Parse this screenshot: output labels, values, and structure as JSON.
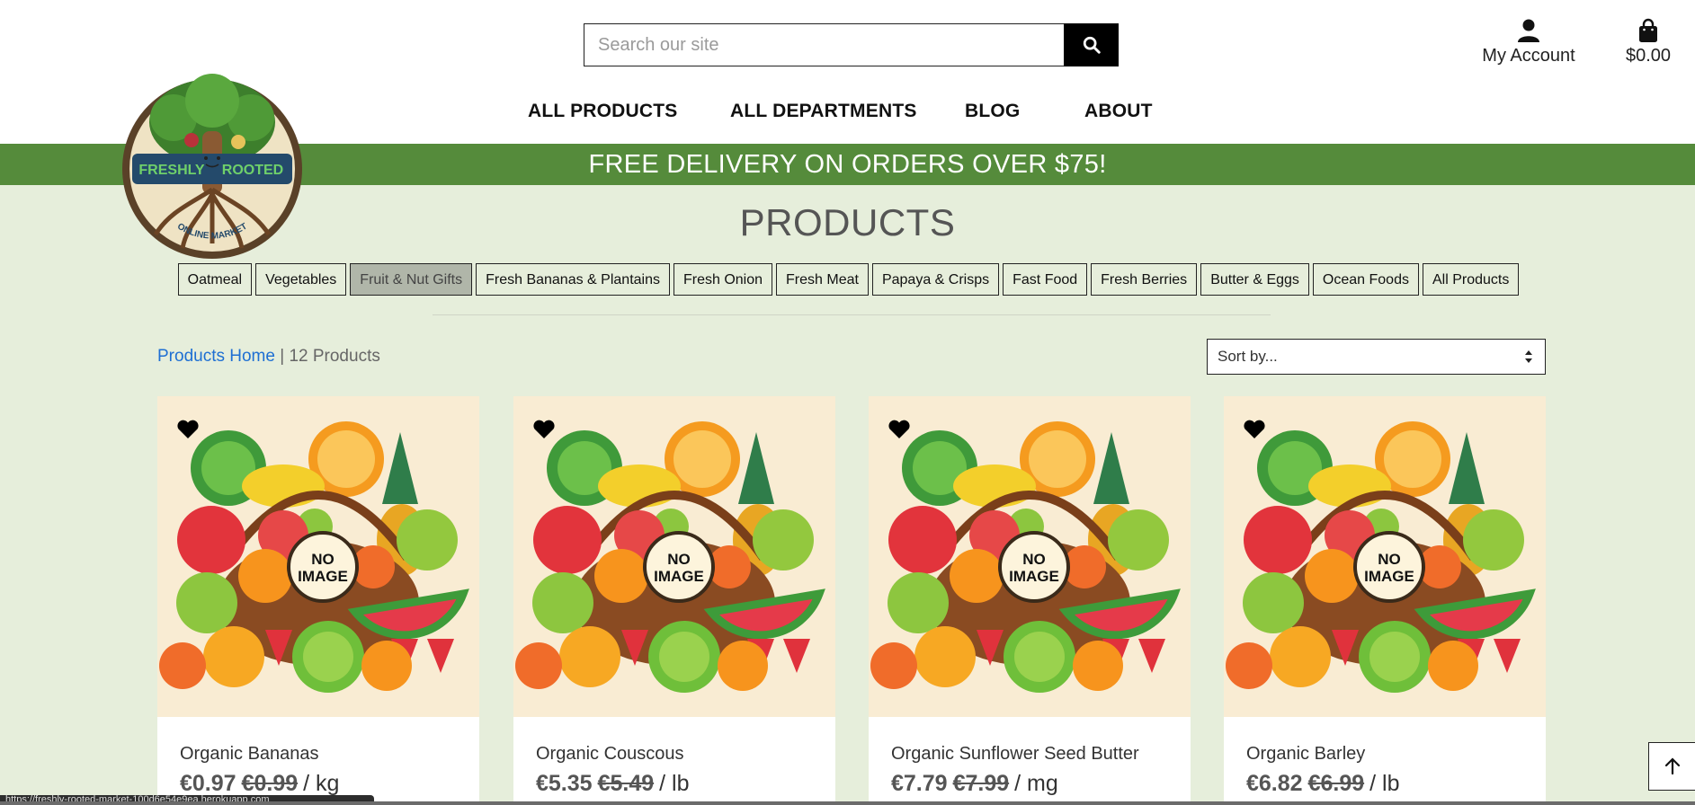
{
  "header": {
    "search_placeholder": "Search our site",
    "account_label": "My Account",
    "cart_total": "$0.00",
    "icons": [
      "search-icon",
      "user-icon",
      "shopping-bag-icon"
    ]
  },
  "nav": [
    "ALL PRODUCTS",
    "ALL DEPARTMENTS",
    "BLOG",
    "ABOUT"
  ],
  "banner": "FREE DELIVERY ON ORDERS OVER $75!",
  "logo_text": "FRESHLY ROOTED ONLINE MARKET",
  "page_title": "PRODUCTS",
  "categories": [
    {
      "label": "Oatmeal",
      "active": false
    },
    {
      "label": "Vegetables",
      "active": false
    },
    {
      "label": "Fruit & Nut Gifts",
      "active": true
    },
    {
      "label": "Fresh Bananas & Plantains",
      "active": false
    },
    {
      "label": "Fresh Onion",
      "active": false
    },
    {
      "label": "Fresh Meat",
      "active": false
    },
    {
      "label": "Papaya & Crisps",
      "active": false
    },
    {
      "label": "Fast Food",
      "active": false
    },
    {
      "label": "Fresh Berries",
      "active": false
    },
    {
      "label": "Butter & Eggs",
      "active": false
    },
    {
      "label": "Ocean Foods",
      "active": false
    },
    {
      "label": "All Products",
      "active": false
    }
  ],
  "breadcrumb": {
    "link": "Products Home",
    "separator": " | ",
    "count": "12 Products"
  },
  "sort": {
    "selected": "Sort by..."
  },
  "image_placeholder_text": [
    "NO",
    "IMAGE"
  ],
  "products": [
    {
      "name": "Organic Bananas",
      "price": "€0.97",
      "old_price": "€0.99",
      "unit": "/ kg"
    },
    {
      "name": "Organic Couscous",
      "price": "€5.35",
      "old_price": "€5.49",
      "unit": "/ lb"
    },
    {
      "name": "Organic Sunflower Seed Butter",
      "price": "€7.79",
      "old_price": "€7.99",
      "unit": "/ mg"
    },
    {
      "name": "Organic Barley",
      "price": "€6.82",
      "old_price": "€6.99",
      "unit": "/ lb"
    }
  ],
  "status_bar": "https://freshly-rooted-market-100d6e54e9ea.herokuapp.com",
  "colors": {
    "banner": "#558b3b",
    "background": "#e6eedb",
    "link": "#1e6fd3",
    "active_category": "#b0b6a9"
  }
}
